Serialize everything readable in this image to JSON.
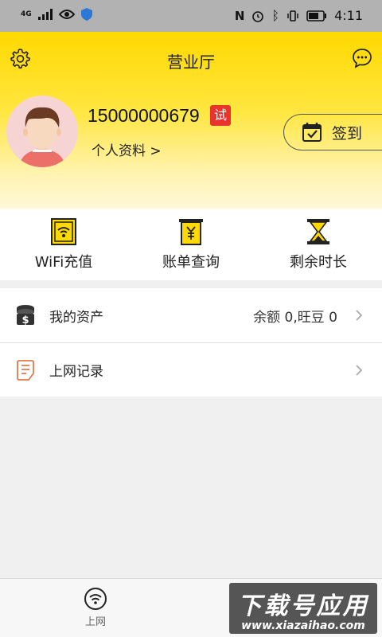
{
  "status_bar": {
    "network": "4G",
    "time": "4:11"
  },
  "header": {
    "title": "营业厅"
  },
  "user": {
    "phone": "15000000679",
    "badge": "试",
    "profile_link": "个人资料 >"
  },
  "signin": {
    "label": "签到"
  },
  "quick_actions": [
    {
      "label": "WiFi充值",
      "icon": "wifi-card-icon"
    },
    {
      "label": "账单查询",
      "icon": "bill-icon"
    },
    {
      "label": "剩余时长",
      "icon": "hourglass-icon"
    }
  ],
  "list": [
    {
      "label": "我的资产",
      "value": "余额 0,旺豆 0",
      "icon": "coins-icon"
    },
    {
      "label": "上网记录",
      "value": "",
      "icon": "document-icon"
    }
  ],
  "bottom_nav": [
    {
      "label": "上网",
      "icon": "wifi-icon"
    }
  ],
  "watermark": {
    "title": "下载号应用",
    "url": "www.xiazaihao.com"
  },
  "colors": {
    "accent": "#ffd900",
    "badge": "#e8342d",
    "record_icon": "#e07a4c"
  }
}
